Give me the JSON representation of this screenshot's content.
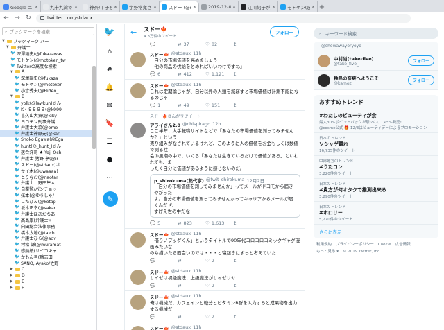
{
  "browser": {
    "tabs": [
      {
        "title": "Google ニュース",
        "color": "#4285f4"
      },
      {
        "title": "九十九湾でアジフ",
        "color": "#e8eaed"
      },
      {
        "title": "神奈川-子どもを",
        "color": "#e8eaed"
      },
      {
        "title": "宇野常寛さんはT",
        "color": "#1da1f2"
      },
      {
        "title": "スドー (@stdau",
        "color": "#1da1f2",
        "active": true
      },
      {
        "title": "2019-12-03_ur",
        "color": "#9aa0a6"
      },
      {
        "title": "江川紹子が抱えた",
        "color": "#202124"
      },
      {
        "title": "モトケン(@moto",
        "color": "#1da1f2"
      }
    ],
    "url": "twitter.com/stdaux"
  },
  "bookmarks": {
    "search_placeholder": "ブックマークを検索",
    "rows": [
      {
        "label": "ブックマーク バー",
        "type": "folder",
        "indent": 0,
        "open": true
      },
      {
        "label": "弁護士",
        "type": "folder",
        "indent": 1,
        "open": true
      },
      {
        "label": "深澤諭史(@fukazawas",
        "type": "tw",
        "indent": 2
      },
      {
        "label": "モトケン(@motoken_tw",
        "type": "tw",
        "indent": 2
      },
      {
        "label": "Twitterの高度な検索",
        "type": "tw",
        "indent": 2
      },
      {
        "label": "A",
        "type": "folder",
        "indent": 2,
        "open": true
      },
      {
        "label": "深澤諭史(@fukaza",
        "type": "tw",
        "indent": 3
      },
      {
        "label": "モトケン(@motoken",
        "type": "tw",
        "indent": 3
      },
      {
        "label": "小倉秀夫(@Hideo_",
        "type": "tw",
        "indent": 3
      },
      {
        "label": "B",
        "type": "folder",
        "indent": 2,
        "open": true
      },
      {
        "label": "yolk(@lawkun)さん",
        "type": "tw",
        "indent": 3
      },
      {
        "label": "K・９９９９(@k999",
        "type": "tw",
        "indent": 3
      },
      {
        "label": "喜久山大貴(@kiky",
        "type": "tw",
        "indent": 3
      },
      {
        "label": "ヨコチン刑事弁護",
        "type": "tw",
        "indent": 3
      },
      {
        "label": "弁護士大森(@omo",
        "type": "tw",
        "indent": 3
      },
      {
        "label": "弁護士神原元(@kar",
        "type": "tw",
        "indent": 3,
        "selected": true
      },
      {
        "label": "Shoko Egawa(@Ega",
        "type": "tw",
        "indent": 3
      },
      {
        "label": "hunt(@_hunt_)さん",
        "type": "tw",
        "indent": 3
      },
      {
        "label": "落合洋司 ♠ Yoji Ochi",
        "type": "tw",
        "indent": 3
      },
      {
        "label": "弁護士 猪野 亨(@ir",
        "type": "tw",
        "indent": 3
      },
      {
        "label": "スドー(@stdaux)さ",
        "type": "tw",
        "indent": 3
      },
      {
        "label": "サイ木(@uwaaaa)",
        "type": "tw",
        "indent": 3
      },
      {
        "label": "とりなお(@naotar",
        "type": "tw",
        "indent": 3
      },
      {
        "label": "弁護士　野田隼人",
        "type": "tw",
        "indent": 3
      },
      {
        "label": "自業監/パンチョッ",
        "type": "tw",
        "indent": 3
      },
      {
        "label": "弦本(@ゆうしゃ/",
        "type": "tw",
        "indent": 3
      },
      {
        "label": "こたぴん(@kotap",
        "type": "tw",
        "indent": 3
      },
      {
        "label": "坂本正幸(@sakar",
        "type": "tw",
        "indent": 3
      },
      {
        "label": "弁護士ほあだちあ",
        "type": "tw",
        "indent": 3
      },
      {
        "label": "髙島康(弁護士)(",
        "type": "tw",
        "indent": 3
      },
      {
        "label": "向田総合法律事務",
        "type": "tw",
        "indent": 3
      },
      {
        "label": "橋本太地(@taichi",
        "type": "tw",
        "indent": 3
      },
      {
        "label": "弁護士ひら(@adv",
        "type": "tw",
        "indent": 3
      },
      {
        "label": "村松 謙(@muramat",
        "type": "tw",
        "indent": 3
      },
      {
        "label": "感熱紙(サイコキャ",
        "type": "tw",
        "indent": 3
      },
      {
        "label": "かもん弓(鴨志田",
        "type": "tw",
        "indent": 3
      },
      {
        "label": "SANO, Ayako/佐野",
        "type": "tw",
        "indent": 3
      },
      {
        "label": "C",
        "type": "folder",
        "indent": 2,
        "open": false
      },
      {
        "label": "D",
        "type": "folder",
        "indent": 2,
        "open": false
      },
      {
        "label": "E",
        "type": "folder",
        "indent": 2,
        "open": false
      },
      {
        "label": "F",
        "type": "folder",
        "indent": 2,
        "open": false
      }
    ]
  },
  "profile": {
    "name": "スドー🍁",
    "tweet_count": "4.3万件のツイート",
    "follow_label": "フォロー"
  },
  "top_metrics": [
    "37",
    "82"
  ],
  "tweets": [
    {
      "name": "スドー🍁",
      "handle": "@stdaux",
      "time": "11h",
      "lines": [
        "「自分の市場価値を高めましょう」",
        "「他の商品の供給をとめればいいわけですね」"
      ],
      "metrics": [
        "6",
        "412",
        "1,121"
      ]
    },
    {
      "name": "スドー🍁",
      "handle": "@stdaux",
      "time": "11h",
      "lines": [
        "これは定期論じゃが、自分以外の人類を滅ぼすと市場価値は計測不能になるのじゃ"
      ],
      "metrics": [
        "1",
        "49",
        "151"
      ]
    },
    {
      "retweet": "スドー🍁さんがリツイート",
      "name": "アライさん2.0",
      "handle": "@chispirago",
      "time": "12h",
      "lines": [
        "ここ半年、大手転職サイトなどで「あなたの市場価値を測ってみませんか？」という",
        "売り組みがなされているけれど、このように人の価値をお金もしくは数値で測る社",
        "会の風潮の中で、いくら「あなたは生きているだけで価値がある」といわれても、ま",
        "ったく自分に価値があるように感じないのだ。"
      ],
      "quote": {
        "name": "p_shirokuma(熊代亨)",
        "handle": "@twit_shirokuma",
        "date": "12月2日",
        "lines": [
          "「自分の市場価値を測ってみませんか」ってメールがドコモから届きやがった",
          "よ。自分の市場価値を測ってみませんかってキャリアからメールが届くんだぜ、",
          "すげえ世の中だな"
        ]
      },
      "metrics": [
        "5",
        "823",
        "1,613"
      ]
    },
    {
      "name": "スドー🍁",
      "handle": "@stdaux",
      "time": "11h",
      "lines": [
        "「借りノブッダくん」というタイトルで90年代コロコロコミックギャグ漫画みたいな",
        "のも描いたら面白いのでは・・・と寝起きにずっと考えていた"
      ],
      "metrics": [
        "",
        "",
        "2"
      ]
    },
    {
      "name": "スドー🍁",
      "handle": "@stdaux",
      "time": "11h",
      "lines": [
        "サイゼは初級魔法、上級魔法がサイゼリヤ"
      ],
      "metrics": [
        "",
        "",
        "2"
      ]
    },
    {
      "name": "スドー🍁",
      "handle": "@stdaux",
      "time": "11h",
      "lines": [
        "俺は機械だ、カフェインと糖分とビタミンB群を入力すると成果物を出力する機械だ"
      ],
      "metrics": [
        "",
        "",
        "2"
      ]
    },
    {
      "name": "スドー🍁",
      "handle": "@stdaux",
      "time": "11h",
      "lines": [
        "労働は健康に悪い、労働をやめろ"
      ],
      "metrics": []
    }
  ],
  "right": {
    "search_placeholder": "キーワード検索",
    "who_to_follow": [
      {
        "name": "",
        "handle": "@showawayoryoyo",
        "follow": ""
      },
      {
        "name": "中村尚(take-five)",
        "handle": "@take_five_",
        "follow": "フォロー"
      },
      {
        "name": "釉島の奈爽へようこそ",
        "handle": "@kamozi",
        "follow": "フォロー"
      }
    ],
    "trends_title": "おすすめトレンド",
    "trends": [
      {
        "cat": "",
        "name": "#わたしのビューティが余",
        "cnt": "最大30%ポイントバックが祭!ベスコス5%発売!",
        "cnt2": "@cosme公式 🎁 12/3はビューティデーによるプロモーション"
      },
      {
        "cat": "日本のトレンド",
        "name": "ソシャゲ離れ",
        "cnt": "16,735件のツイート"
      },
      {
        "cat": "中部地方のトレンド",
        "name": "#うたコン",
        "cnt": "3,220件のツイート"
      },
      {
        "cat": "日本のトレンド",
        "name": "#貴方が何オタクで推測出来る",
        "cnt": "3,290件のツイート"
      },
      {
        "cat": "日本のトレンド",
        "name": "#ホロリー",
        "cnt": "5,270件のツイート"
      }
    ],
    "more_label": "さらに表示",
    "footer": [
      "利用規約",
      "プライバシーポリシー",
      "Cookie",
      "広告情報",
      "もっと見る ▾",
      "© 2019 Twitter, Inc."
    ]
  }
}
